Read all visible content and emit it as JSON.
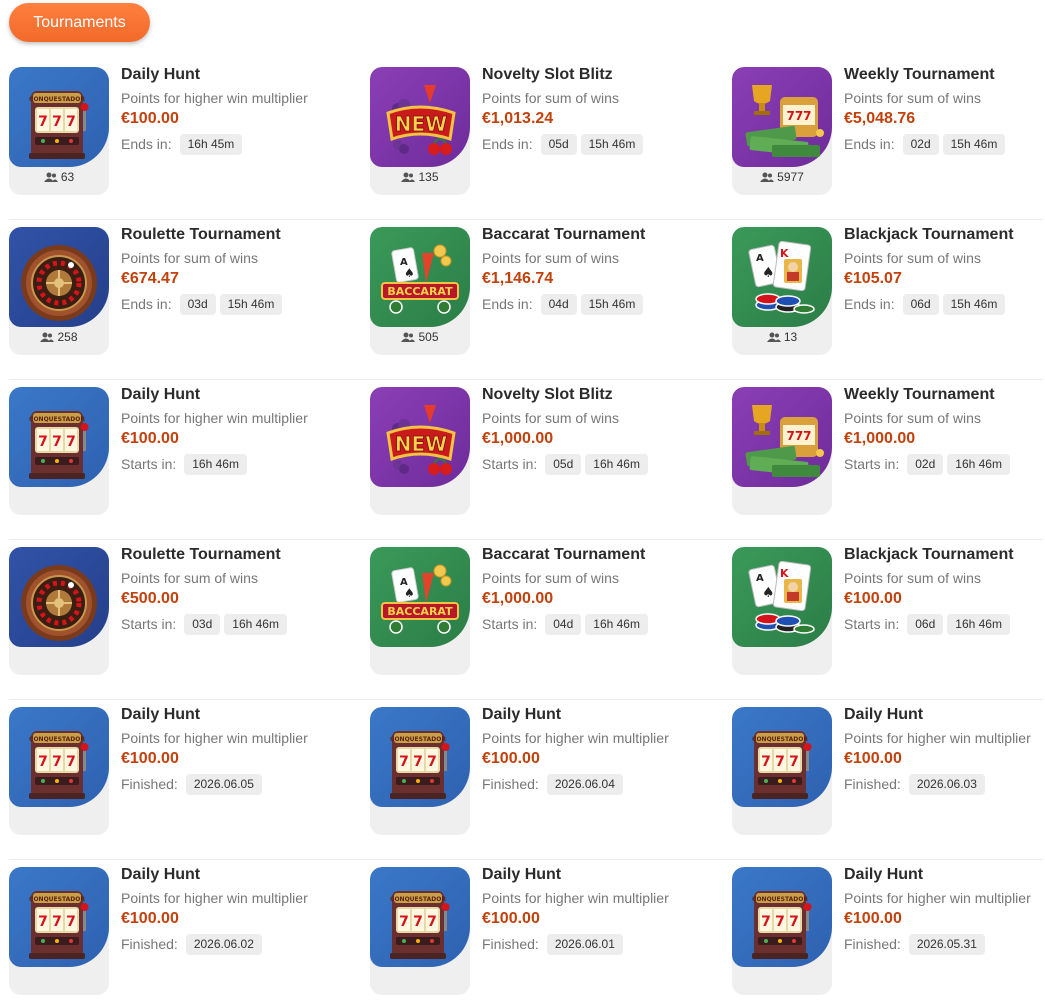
{
  "header": {
    "tab_label": "Tournaments"
  },
  "rows": [
    [
      {
        "title": "Daily Hunt",
        "desc": "Points for higher win multiplier",
        "prize": "€100.00",
        "timer_label": "Ends in:",
        "chips": [
          "16h 45m"
        ],
        "players": "63",
        "theme": "slot",
        "icon": "slot-machine-icon"
      },
      {
        "title": "Novelty Slot Blitz",
        "desc": "Points for sum of wins",
        "prize": "€1,013.24",
        "timer_label": "Ends in:",
        "chips": [
          "05d",
          "15h 46m"
        ],
        "players": "135",
        "theme": "new",
        "icon": "new-badge-icon"
      },
      {
        "title": "Weekly Tournament",
        "desc": "Points for sum of wins",
        "prize": "€5,048.76",
        "timer_label": "Ends in:",
        "chips": [
          "02d",
          "15h 46m"
        ],
        "players": "5977",
        "theme": "trophy",
        "icon": "trophy-slot-icon"
      }
    ],
    [
      {
        "title": "Roulette Tournament",
        "desc": "Points for sum of wins",
        "prize": "€674.47",
        "timer_label": "Ends in:",
        "chips": [
          "03d",
          "15h 46m"
        ],
        "players": "258",
        "theme": "roulette",
        "icon": "roulette-wheel-icon"
      },
      {
        "title": "Baccarat Tournament",
        "desc": "Points for sum of wins",
        "prize": "€1,146.74",
        "timer_label": "Ends in:",
        "chips": [
          "04d",
          "15h 46m"
        ],
        "players": "505",
        "theme": "baccarat",
        "icon": "baccarat-icon"
      },
      {
        "title": "Blackjack Tournament",
        "desc": "Points for sum of wins",
        "prize": "€105.07",
        "timer_label": "Ends in:",
        "chips": [
          "06d",
          "15h 46m"
        ],
        "players": "13",
        "theme": "blackjack",
        "icon": "blackjack-cards-icon"
      }
    ],
    [
      {
        "title": "Daily Hunt",
        "desc": "Points for higher win multiplier",
        "prize": "€100.00",
        "timer_label": "Starts in:",
        "chips": [
          "16h 46m"
        ],
        "players": "",
        "theme": "slot",
        "icon": "slot-machine-icon"
      },
      {
        "title": "Novelty Slot Blitz",
        "desc": "Points for sum of wins",
        "prize": "€1,000.00",
        "timer_label": "Starts in:",
        "chips": [
          "05d",
          "16h 46m"
        ],
        "players": "",
        "theme": "new",
        "icon": "new-badge-icon"
      },
      {
        "title": "Weekly Tournament",
        "desc": "Points for sum of wins",
        "prize": "€1,000.00",
        "timer_label": "Starts in:",
        "chips": [
          "02d",
          "16h 46m"
        ],
        "players": "",
        "theme": "trophy",
        "icon": "trophy-slot-icon"
      }
    ],
    [
      {
        "title": "Roulette Tournament",
        "desc": "Points for sum of wins",
        "prize": "€500.00",
        "timer_label": "Starts in:",
        "chips": [
          "03d",
          "16h 46m"
        ],
        "players": "",
        "theme": "roulette",
        "icon": "roulette-wheel-icon"
      },
      {
        "title": "Baccarat Tournament",
        "desc": "Points for sum of wins",
        "prize": "€1,000.00",
        "timer_label": "Starts in:",
        "chips": [
          "04d",
          "16h 46m"
        ],
        "players": "",
        "theme": "baccarat",
        "icon": "baccarat-icon"
      },
      {
        "title": "Blackjack Tournament",
        "desc": "Points for sum of wins",
        "prize": "€100.00",
        "timer_label": "Starts in:",
        "chips": [
          "06d",
          "16h 46m"
        ],
        "players": "",
        "theme": "blackjack",
        "icon": "blackjack-cards-icon"
      }
    ],
    [
      {
        "title": "Daily Hunt",
        "desc": "Points for higher win multiplier",
        "prize": "€100.00",
        "timer_label": "Finished:",
        "chips": [
          "2026.06.05"
        ],
        "players": "",
        "theme": "slot",
        "icon": "slot-machine-icon"
      },
      {
        "title": "Daily Hunt",
        "desc": "Points for higher win multiplier",
        "prize": "€100.00",
        "timer_label": "Finished:",
        "chips": [
          "2026.06.04"
        ],
        "players": "",
        "theme": "slot",
        "icon": "slot-machine-icon"
      },
      {
        "title": "Daily Hunt",
        "desc": "Points for higher win multiplier",
        "prize": "€100.00",
        "timer_label": "Finished:",
        "chips": [
          "2026.06.03"
        ],
        "players": "",
        "theme": "slot",
        "icon": "slot-machine-icon"
      }
    ],
    [
      {
        "title": "Daily Hunt",
        "desc": "Points for higher win multiplier",
        "prize": "€100.00",
        "timer_label": "Finished:",
        "chips": [
          "2026.06.02"
        ],
        "players": "",
        "theme": "slot",
        "icon": "slot-machine-icon"
      },
      {
        "title": "Daily Hunt",
        "desc": "Points for higher win multiplier",
        "prize": "€100.00",
        "timer_label": "Finished:",
        "chips": [
          "2026.06.01"
        ],
        "players": "",
        "theme": "slot",
        "icon": "slot-machine-icon"
      },
      {
        "title": "Daily Hunt",
        "desc": "Points for higher win multiplier",
        "prize": "€100.00",
        "timer_label": "Finished:",
        "chips": [
          "2026.05.31"
        ],
        "players": "",
        "theme": "slot",
        "icon": "slot-machine-icon"
      }
    ]
  ],
  "thumbnail_texts": {
    "slot_brand": "CONQUESTADOR",
    "new_badge": "NEW",
    "baccarat_banner": "BACCARAT",
    "card_letters": [
      "A",
      "K"
    ]
  },
  "colors": {
    "accent": "#f26a2a",
    "prize": "#c2410c",
    "chip_bg": "#ededed",
    "thumb_bg": "#efefef"
  }
}
